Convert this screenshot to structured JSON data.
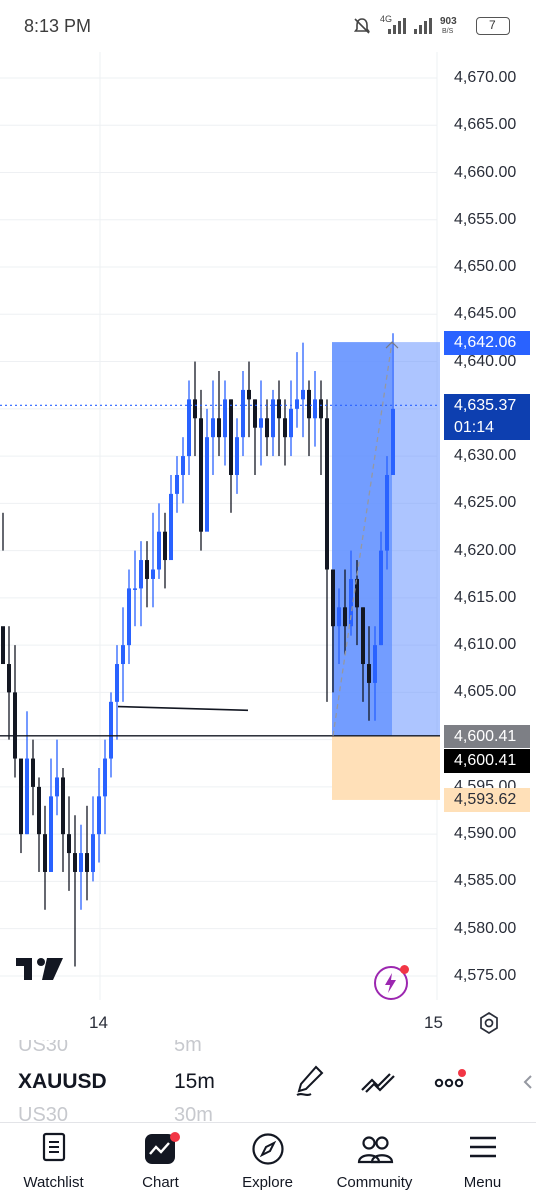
{
  "status_bar": {
    "time": "8:13 PM",
    "net_speed_value": "903",
    "net_speed_unit": "B/S",
    "network_type": "4G",
    "battery_level": "7"
  },
  "chart": {
    "price_axis_labels": [
      "4,670.00",
      "4,665.00",
      "4,660.00",
      "4,655.00",
      "4,650.00",
      "4,645.00",
      "4,640.00",
      "4,635.00",
      "4,630.00",
      "4,625.00",
      "4,620.00",
      "4,615.00",
      "4,610.00",
      "4,605.00",
      "4,600.00",
      "4,595.00",
      "4,590.00",
      "4,585.00",
      "4,580.00",
      "4,575.00"
    ],
    "time_axis_labels": [
      "14",
      "15"
    ],
    "current_price": "4,635.37",
    "countdown": "01:14",
    "position_target": "4,642.06",
    "position_entry": "4,600.41",
    "entry_line_price": "4,600.41",
    "position_stop": "4,593.62",
    "colors": {
      "up_candle": "#2962ff",
      "down_candle": "#131722",
      "profit_zone": "#5b8cff",
      "loss_zone": "#ffe0b8",
      "current_price_tag": "#0d3fb0"
    }
  },
  "symbol_bar": {
    "symbol": "XAUUSD",
    "interval": "15m",
    "ghost_symbol_above": "US30",
    "ghost_interval_above": "5m",
    "ghost_symbol_below": "US30",
    "ghost_interval_below": "30m"
  },
  "bottom_nav": [
    {
      "label": "Watchlist",
      "icon": "watchlist-icon"
    },
    {
      "label": "Chart",
      "icon": "chart-icon"
    },
    {
      "label": "Explore",
      "icon": "compass-icon"
    },
    {
      "label": "Community",
      "icon": "community-icon"
    },
    {
      "label": "Menu",
      "icon": "menu-icon"
    }
  ]
}
